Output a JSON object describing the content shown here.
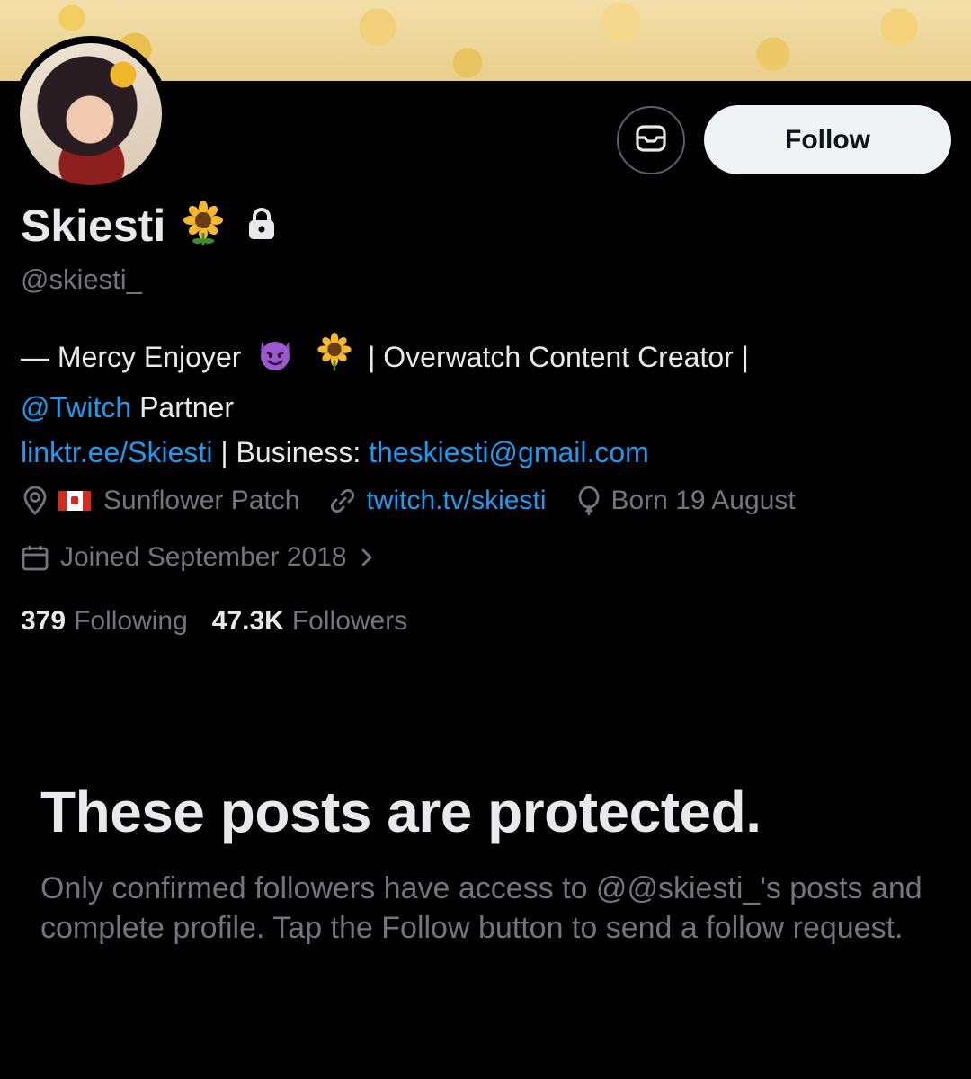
{
  "profile": {
    "name": "Skiesti",
    "handle": "@skiesti_",
    "name_emoji": "🌻",
    "follow_label": "Follow"
  },
  "bio": {
    "line1_prefix": "— Mercy Enjoyer",
    "line1_emoji_1": "😈",
    "line1_emoji_2": "🌻",
    "line1_suffix": "| Overwatch Content Creator |",
    "line2_link": "@Twitch",
    "line2_text": " Partner",
    "line3_link": "linktr.ee/Skiesti",
    "line3_text": " | Business: ",
    "line3_email": "theskiesti@gmail.com"
  },
  "meta": {
    "location": "Sunflower Patch",
    "website": "twitch.tv/skiesti",
    "birthday": "Born 19 August",
    "joined": "Joined September 2018"
  },
  "counts": {
    "following_num": "379",
    "following_label": "Following",
    "followers_num": "47.3K",
    "followers_label": "Followers"
  },
  "protected": {
    "title": "These posts are protected.",
    "description": "Only confirmed followers have access to @@skiesti_'s posts and complete profile. Tap the Follow button to send a follow request."
  },
  "colors": {
    "background": "#000000",
    "text_primary": "#e7e9ea",
    "text_secondary": "#71767b",
    "link": "#1d9bf0",
    "follow_bg": "#eff3f4"
  }
}
